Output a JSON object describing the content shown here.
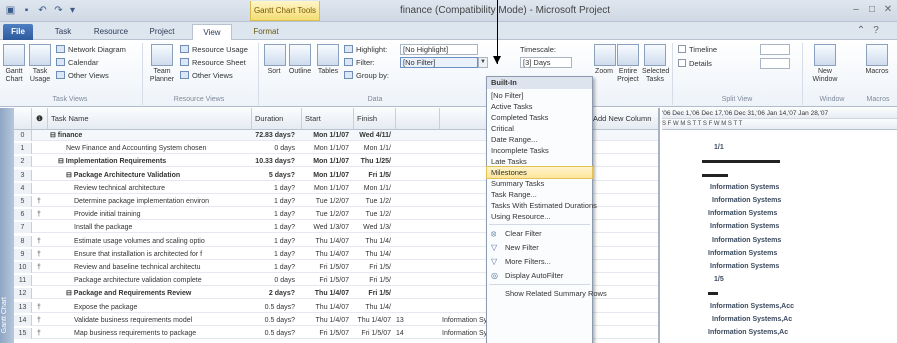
{
  "titlebar": {
    "context_tab": "Gantt Chart Tools",
    "window_title": "finance (Compatibility Mode) - Microsoft Project"
  },
  "tabs": [
    "File",
    "Task",
    "Resource",
    "Project",
    "View",
    "Format"
  ],
  "ribbon": {
    "task_views": {
      "gantt_label": "Gantt Chart",
      "task_usage_label": "Task Usage",
      "network_diagram": "Network Diagram",
      "calendar": "Calendar",
      "other_views": "Other Views",
      "group_label": "Task Views"
    },
    "resource_views": {
      "team_planner_label": "Team Planner",
      "resource_usage": "Resource Usage",
      "resource_sheet": "Resource Sheet",
      "other_views": "Other Views",
      "group_label": "Resource Views"
    },
    "data": {
      "sort": "Sort",
      "outline": "Outline",
      "tables": "Tables",
      "highlight_label": "Highlight:",
      "highlight_value": "[No Highlight]",
      "filter_label": "Filter:",
      "filter_value": "[No Filter]",
      "group_by_label": "Group by:",
      "group_label": "Data"
    },
    "zoom": {
      "timescale_label": "Timescale:",
      "timescale_value": "[3] Days",
      "zoom": "Zoom",
      "entire_project": "Entire Project",
      "selected_tasks": "Selected Tasks"
    },
    "split_view": {
      "timeline": "Timeline",
      "details": "Details",
      "group_label": "Split View"
    },
    "window": {
      "new_window": "New Window",
      "macros": "Macros",
      "group_label": "Window",
      "macros_group": "Macros"
    }
  },
  "grid": {
    "headers": {
      "indicators": "❶",
      "task_name": "Task Name",
      "duration": "Duration",
      "start": "Start",
      "finish": "Finish",
      "add_column": "Add New Column"
    },
    "rows": [
      {
        "id": "0",
        "ind": "",
        "name": "⊟ finance",
        "dur": "72.83 days?",
        "start": "Mon 1/1/07",
        "finish": "Wed 4/11/",
        "pred": "",
        "res": "",
        "level": 0,
        "bold": true
      },
      {
        "id": "1",
        "ind": "",
        "name": "New Finance and Accounting System chosen",
        "dur": "0 days",
        "start": "Mon 1/1/07",
        "finish": "Mon 1/1/",
        "pred": "",
        "res": "",
        "level": 2,
        "bold": false
      },
      {
        "id": "2",
        "ind": "",
        "name": "⊟ Implementation Requirements",
        "dur": "10.33 days?",
        "start": "Mon 1/1/07",
        "finish": "Thu 1/25/",
        "pred": "",
        "res": "",
        "level": 1,
        "bold": true
      },
      {
        "id": "3",
        "ind": "",
        "name": "⊟ Package Architecture Validation",
        "dur": "5 days?",
        "start": "Mon 1/1/07",
        "finish": "Fri 1/5/",
        "pred": "",
        "res": "",
        "level": 2,
        "bold": true
      },
      {
        "id": "4",
        "ind": "",
        "name": "Review technical architecture",
        "dur": "1 day?",
        "start": "Mon 1/1/07",
        "finish": "Mon 1/1/",
        "pred": "",
        "res": "",
        "level": 3,
        "bold": false
      },
      {
        "id": "5",
        "ind": "†",
        "name": "Determine package implementation environ",
        "dur": "1 day?",
        "start": "Tue 1/2/07",
        "finish": "Tue 1/2/",
        "pred": "",
        "res": "",
        "level": 3,
        "bold": false
      },
      {
        "id": "6",
        "ind": "†",
        "name": "Provide initial training",
        "dur": "1 day?",
        "start": "Tue 1/2/07",
        "finish": "Tue 1/2/",
        "pred": "",
        "res": "",
        "level": 3,
        "bold": false
      },
      {
        "id": "7",
        "ind": "",
        "name": "Install the package",
        "dur": "1 day?",
        "start": "Wed 1/3/07",
        "finish": "Wed 1/3/",
        "pred": "",
        "res": "",
        "level": 3,
        "bold": false
      },
      {
        "id": "8",
        "ind": "†",
        "name": "Estimate usage volumes and scaling optio",
        "dur": "1 day?",
        "start": "Thu 1/4/07",
        "finish": "Thu 1/4/",
        "pred": "",
        "res": "",
        "level": 3,
        "bold": false
      },
      {
        "id": "9",
        "ind": "†",
        "name": "Ensure that installation is architected for f",
        "dur": "1 day?",
        "start": "Thu 1/4/07",
        "finish": "Thu 1/4/",
        "pred": "",
        "res": "",
        "level": 3,
        "bold": false
      },
      {
        "id": "10",
        "ind": "†",
        "name": "Review and baseline technical architectu",
        "dur": "1 day?",
        "start": "Fri 1/5/07",
        "finish": "Fri 1/5/",
        "pred": "",
        "res": "",
        "level": 3,
        "bold": false
      },
      {
        "id": "11",
        "ind": "",
        "name": "Package architecture validation complete",
        "dur": "0 days",
        "start": "Fri 1/5/07",
        "finish": "Fri 1/5/",
        "pred": "",
        "res": "",
        "level": 3,
        "bold": false
      },
      {
        "id": "12",
        "ind": "",
        "name": "⊟ Package and Requirements Review",
        "dur": "2 days?",
        "start": "Thu 1/4/07",
        "finish": "Fri 1/5/",
        "pred": "",
        "res": "",
        "level": 2,
        "bold": true
      },
      {
        "id": "13",
        "ind": "†",
        "name": "Expose the package",
        "dur": "0.5 days?",
        "start": "Thu 1/4/07",
        "finish": "Thu 1/4/",
        "pred": "",
        "res": "",
        "level": 3,
        "bold": false
      },
      {
        "id": "14",
        "ind": "†",
        "name": "Validate business requirements model",
        "dur": "0.5 days?",
        "start": "Thu 1/4/07",
        "finish": "Thu 1/4/07",
        "pred": "13",
        "res": "Information Systems,",
        "level": 3,
        "bold": false
      },
      {
        "id": "15",
        "ind": "†",
        "name": "Map business requirements to package",
        "dur": "0.5 days?",
        "start": "Fri 1/5/07",
        "finish": "Fri 1/5/07",
        "pred": "14",
        "res": "Information Systems,",
        "level": 3,
        "bold": false
      }
    ]
  },
  "gantt": {
    "weeks": "'06 Dec 1,'06  Dec 17,'06  Dec 31,'06  Jan 14,'07  Jan 28,'07",
    "days": "S  F  W  M  S  T  T  S  F  W  M  S  T  T",
    "labels": [
      {
        "row": 1,
        "text": "1/1"
      },
      {
        "row": 4,
        "text": "Information Systems"
      },
      {
        "row": 5,
        "text": "Information Systems"
      },
      {
        "row": 6,
        "text": "Information Systems"
      },
      {
        "row": 7,
        "text": "Information Systems"
      },
      {
        "row": 8,
        "text": "Information Systems"
      },
      {
        "row": 9,
        "text": "Information Systems"
      },
      {
        "row": 10,
        "text": "Information Systems"
      },
      {
        "row": 11,
        "text": "1/5"
      },
      {
        "row": 13,
        "text": "Information Systems,Acc"
      },
      {
        "row": 14,
        "text": "Information Systems,Ac"
      },
      {
        "row": 15,
        "text": "Information Systems,Ac"
      }
    ]
  },
  "dropdown": {
    "header": "Built-In",
    "items": [
      "[No Filter]",
      "Active Tasks",
      "Completed Tasks",
      "Critical",
      "Date Range...",
      "Incomplete Tasks",
      "Late Tasks",
      "Milestones",
      "Summary Tasks",
      "Task Range...",
      "Tasks With Estimated Durations",
      "Using Resource..."
    ],
    "highlighted_index": 7,
    "commands": [
      {
        "icon": "⦻",
        "label": "Clear Filter"
      },
      {
        "icon": "▽",
        "label": "New Filter"
      },
      {
        "icon": "▽",
        "label": "More Filters..."
      },
      {
        "icon": "◎",
        "label": "Display AutoFilter"
      }
    ],
    "related_summary": "Show Related Summary Rows"
  },
  "view_bar_label": "Gantt Chart"
}
